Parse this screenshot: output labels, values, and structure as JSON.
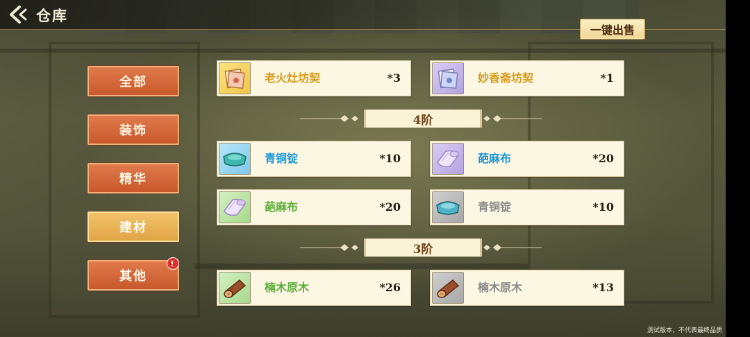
{
  "header": {
    "title": "仓库",
    "back_icon": "back-arrow-icon"
  },
  "toolbar": {
    "sell_all_label": "一键出售"
  },
  "sidebar": {
    "items": [
      {
        "label": "全部",
        "selected": false,
        "badge": ""
      },
      {
        "label": "装饰",
        "selected": false,
        "badge": ""
      },
      {
        "label": "精华",
        "selected": false,
        "badge": ""
      },
      {
        "label": "建材",
        "selected": true,
        "badge": ""
      },
      {
        "label": "其他",
        "selected": false,
        "badge": "!"
      }
    ]
  },
  "inventory": {
    "top_items": [
      {
        "name": "老火灶坊契",
        "qty": "*3",
        "icon": "deed-scroll-icon",
        "rarity_color": "gold"
      },
      {
        "name": "妙香斋坊契",
        "qty": "*1",
        "icon": "deed-scroll-icon",
        "rarity_color": "purple"
      }
    ],
    "tiers": [
      {
        "label": "4阶",
        "items": [
          {
            "name": "青铜锭",
            "qty": "*10",
            "icon": "bronze-ingot-icon",
            "rarity_color": "blue"
          },
          {
            "name": "葩麻布",
            "qty": "*20",
            "icon": "linen-cloth-icon",
            "rarity_color": "blue"
          },
          {
            "name": "葩麻布",
            "qty": "*20",
            "icon": "linen-cloth-icon",
            "rarity_color": "green"
          },
          {
            "name": "青铜锭",
            "qty": "*10",
            "icon": "bronze-ingot-icon",
            "rarity_color": "gray"
          }
        ]
      },
      {
        "label": "3阶",
        "items": [
          {
            "name": "楠木原木",
            "qty": "*26",
            "icon": "wood-log-icon",
            "rarity_color": "green"
          },
          {
            "name": "楠木原木",
            "qty": "*13",
            "icon": "wood-log-icon",
            "rarity_color": "gray"
          }
        ]
      }
    ]
  },
  "footer": {
    "note": "测试版本，不代表最终品质"
  }
}
